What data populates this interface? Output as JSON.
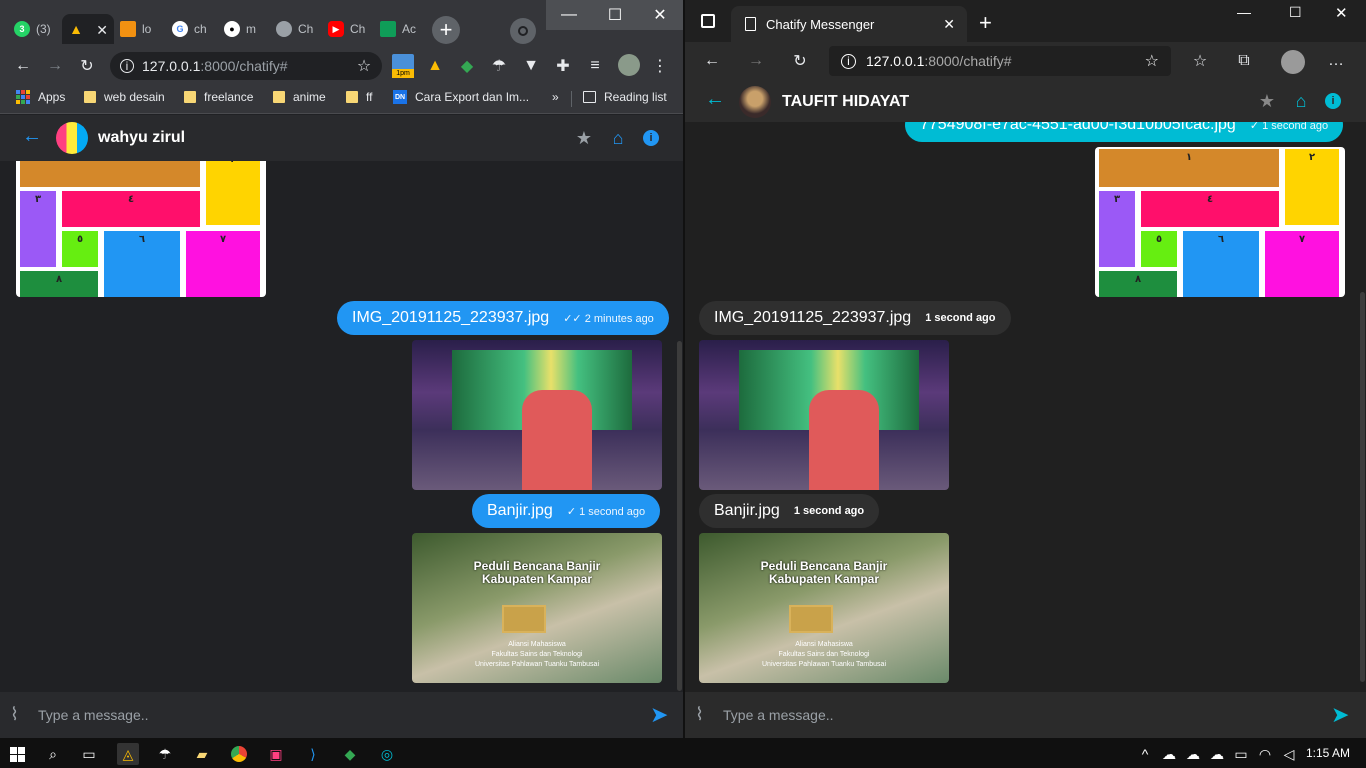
{
  "left_browser": {
    "tabs": [
      {
        "label": "(3)",
        "icon": "whatsapp-icon",
        "color": "#25d366"
      },
      {
        "label": "",
        "icon": "drive-icon",
        "color": "#fbbc04"
      },
      {
        "label": "lo",
        "icon": "pma-icon",
        "color": "#f29111"
      },
      {
        "label": "ch",
        "icon": "google-icon",
        "color": "#4285f4"
      },
      {
        "label": "m",
        "icon": "github-icon",
        "color": "#ffffff"
      },
      {
        "label": "Ch",
        "icon": "globe-icon",
        "color": "#9aa0a6"
      },
      {
        "label": "Ch",
        "icon": "youtube-icon",
        "color": "#ff0000"
      },
      {
        "label": "Ac",
        "icon": "app-icon",
        "color": "#0f9d58"
      }
    ],
    "url_host": "127.0.0.1",
    "url_path": ":8000/chatify#",
    "bookmarks": {
      "apps": "Apps",
      "items": [
        "web desain",
        "freelance",
        "anime",
        "ff",
        "Cara Export dan Im..."
      ],
      "more": "»",
      "reading_list": "Reading list"
    },
    "extension_badge": "1pm"
  },
  "left_chat": {
    "contact_name": "wahyu zirul",
    "messages": [
      {
        "text": "IMG_20191125_223937.jpg",
        "time": "2 minutes ago"
      },
      {
        "text": "Banjir.jpg",
        "time": "1 second ago"
      }
    ],
    "input_placeholder": "Type a message.."
  },
  "right_browser": {
    "tab_title": "Chatify Messenger",
    "url_host": "127.0.0.1",
    "url_path": ":8000/chatify#"
  },
  "right_chat": {
    "contact_name": "TAUFIT HIDAYAT",
    "top_partial": {
      "text": "7754908f-e7ac-4551-ad00-f3d10b05fcac.jpg",
      "time": "1 second ago"
    },
    "messages": [
      {
        "text": "IMG_20191125_223937.jpg",
        "time": "1 second ago"
      },
      {
        "text": "Banjir.jpg",
        "time": "1 second ago"
      }
    ],
    "input_placeholder": "Type a message.."
  },
  "tiles": [
    "١",
    "٢",
    "٣",
    "٤",
    "٥",
    "٦",
    "٧",
    "٨"
  ],
  "poster": {
    "title1": "Peduli Bencana Banjir",
    "title2": "Kabupaten Kampar",
    "sub1": "Aliansi Mahasiswa",
    "sub2": "Fakultas Sains dan Teknologi",
    "sub3": "Universitas Pahlawan Tuanku Tambusai"
  },
  "taskbar": {
    "time": "1:15 AM"
  },
  "colors": {
    "accent": "#2196f3",
    "cyan": "#00bcd4",
    "chat_bg": "#202124"
  }
}
